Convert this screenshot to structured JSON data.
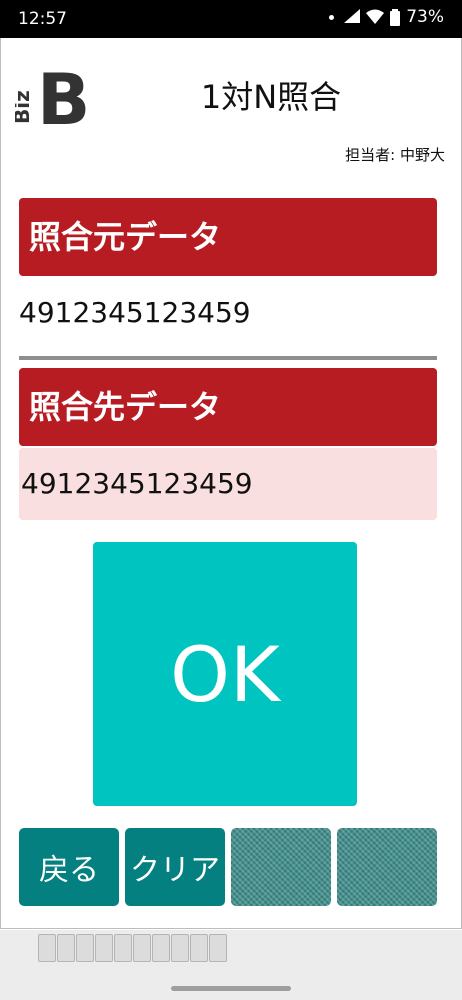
{
  "status_bar": {
    "time": "12:57",
    "battery": "73%",
    "icons": [
      "wifi-icon",
      "signal-icon",
      "battery-icon"
    ]
  },
  "header": {
    "logo_text": "BizB",
    "title": "1対N照合",
    "operator": "担当者: 中野大"
  },
  "source": {
    "label": "照合元データ",
    "value": "4912345123459"
  },
  "target": {
    "label": "照合先データ",
    "value": "4912345123459"
  },
  "result": {
    "label": "OK",
    "color": "#00c4bf"
  },
  "footer": {
    "buttons": [
      {
        "label": "戻る",
        "enabled": true
      },
      {
        "label": "クリア",
        "enabled": true
      },
      {
        "label": "",
        "enabled": false
      },
      {
        "label": "",
        "enabled": false
      }
    ]
  },
  "colors": {
    "header_red": "#b71c22",
    "target_bg": "#f9dfe0",
    "button_teal": "#058080"
  }
}
